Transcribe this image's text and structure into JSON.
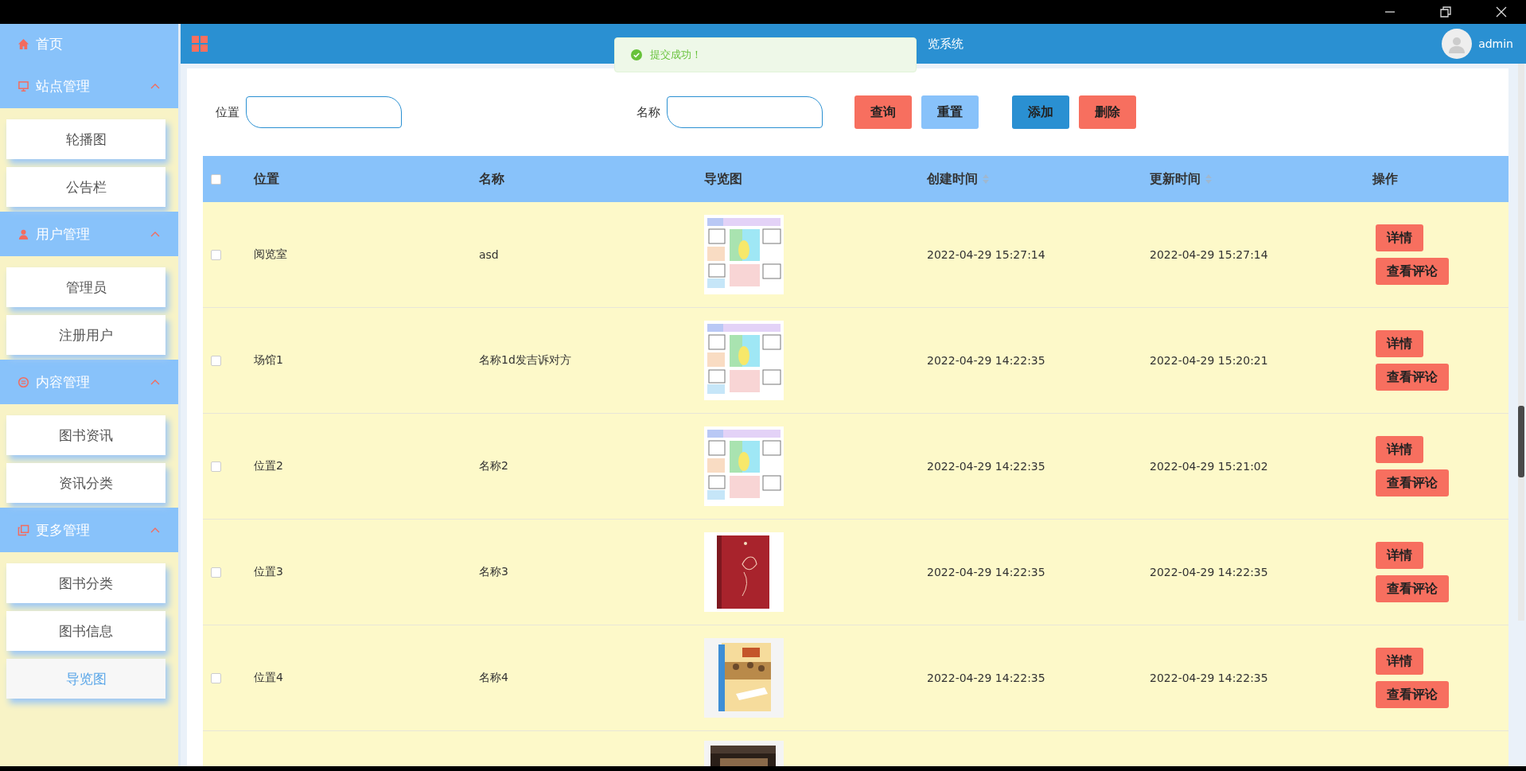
{
  "header": {
    "title_visible": "览系统",
    "user": "admin"
  },
  "toast": {
    "message": "提交成功！"
  },
  "sidebar": {
    "home": "首页",
    "groups": [
      {
        "label": "站点管理",
        "expanded": true,
        "items": [
          {
            "label": "轮播图",
            "selected": false
          },
          {
            "label": "公告栏",
            "selected": false
          }
        ]
      },
      {
        "label": "用户管理",
        "expanded": true,
        "items": [
          {
            "label": "管理员",
            "selected": false
          },
          {
            "label": "注册用户",
            "selected": false
          }
        ]
      },
      {
        "label": "内容管理",
        "expanded": true,
        "items": [
          {
            "label": "图书资讯",
            "selected": false
          },
          {
            "label": "资讯分类",
            "selected": false
          }
        ]
      },
      {
        "label": "更多管理",
        "expanded": true,
        "items": [
          {
            "label": "图书分类",
            "selected": false
          },
          {
            "label": "图书信息",
            "selected": false
          },
          {
            "label": "导览图",
            "selected": true
          }
        ]
      }
    ]
  },
  "search": {
    "fields": [
      {
        "label": "位置"
      },
      {
        "label": "名称"
      }
    ],
    "buttons": [
      {
        "label": "查询",
        "kind": "query"
      },
      {
        "label": "重置",
        "kind": "reset"
      },
      {
        "label": "添加",
        "kind": "add"
      },
      {
        "label": "删除",
        "kind": "delete"
      }
    ]
  },
  "table": {
    "select_all": {
      "checked": false
    },
    "columns": [
      {
        "label": "位置",
        "sortable": false
      },
      {
        "label": "名称",
        "sortable": false
      },
      {
        "label": "导览图",
        "sortable": false
      },
      {
        "label": "创建时间",
        "sortable": true
      },
      {
        "label": "更新时间",
        "sortable": true
      },
      {
        "label": "操作",
        "sortable": false
      }
    ],
    "rows": [
      {
        "checked": false,
        "location": "阅览室",
        "name": "asd",
        "image": {
          "kind": "picture"
        },
        "created": "2022-04-29 15:27:14",
        "updated": "2022-04-29 15:27:14",
        "actions": [
          "详情",
          "查看评论"
        ]
      },
      {
        "checked": false,
        "location": "场馆1",
        "name": "名称1d发吉诉对方",
        "image": {
          "kind": "picture"
        },
        "created": "2022-04-29 14:22:35",
        "updated": "2022-04-29 15:20:21",
        "actions": [
          "详情",
          "查看评论"
        ]
      },
      {
        "checked": false,
        "location": "位置2",
        "name": "名称2",
        "image": {
          "kind": "picture"
        },
        "created": "2022-04-29 14:22:35",
        "updated": "2022-04-29 15:21:02",
        "actions": [
          "详情",
          "查看评论"
        ]
      },
      {
        "checked": false,
        "location": "位置3",
        "name": "名称3",
        "image": {
          "kind": "picture"
        },
        "created": "2022-04-29 14:22:35",
        "updated": "2022-04-29 14:22:35",
        "actions": [
          "详情",
          "查看评论"
        ]
      },
      {
        "checked": false,
        "location": "位置4",
        "name": "名称4",
        "image": {
          "kind": "picture"
        },
        "created": "2022-04-29 14:22:35",
        "updated": "2022-04-29 14:22:35",
        "actions": [
          "详情",
          "查看评论"
        ]
      }
    ],
    "partial_row": {
      "image": {
        "kind": "picture"
      }
    }
  }
}
